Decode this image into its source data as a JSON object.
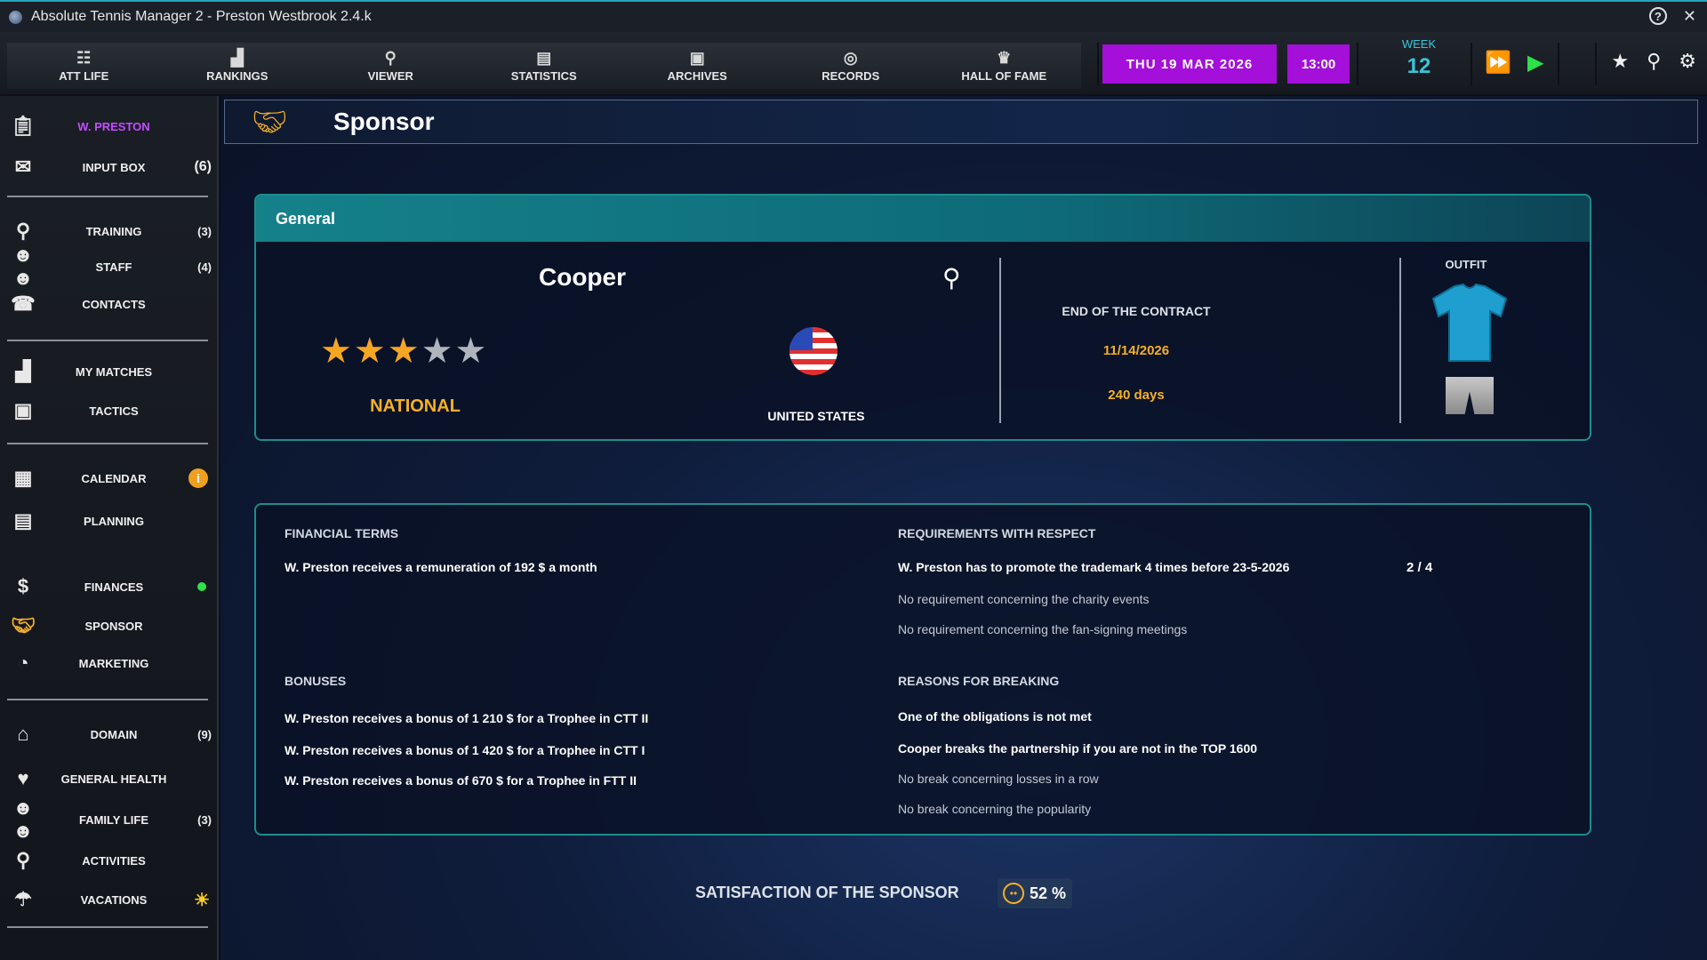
{
  "window": {
    "title": "Absolute Tennis Manager 2  -  Preston Westbrook  2.4.k"
  },
  "nav": {
    "tabs": [
      {
        "label": "ATT LIFE",
        "icon": "att-life-icon"
      },
      {
        "label": "RANKINGS",
        "icon": "rankings-icon"
      },
      {
        "label": "VIEWER",
        "icon": "viewer-icon"
      },
      {
        "label": "STATISTICS",
        "icon": "statistics-icon"
      },
      {
        "label": "ARCHIVES",
        "icon": "archives-icon"
      },
      {
        "label": "RECORDS",
        "icon": "records-icon"
      },
      {
        "label": "HALL OF FAME",
        "icon": "hall-of-fame-icon"
      }
    ],
    "date": "THU  19  MAR  2026",
    "time": "13:00",
    "week_label": "WEEK",
    "week_number": "12"
  },
  "sidebar": {
    "items": [
      {
        "label": "W. PRESTON",
        "count": "",
        "icon": "clipboard-icon",
        "active": true
      },
      {
        "label": "INPUT BOX",
        "count": "(6)",
        "icon": "envelope-icon"
      },
      {
        "label": "TRAINING",
        "count": "(3)",
        "icon": "racket-icon"
      },
      {
        "label": "STAFF",
        "count": "(4)",
        "icon": "staff-icon"
      },
      {
        "label": "CONTACTS",
        "count": "",
        "icon": "contacts-icon"
      },
      {
        "label": "MY MATCHES",
        "count": "",
        "icon": "bar-chart-icon"
      },
      {
        "label": "TACTICS",
        "count": "",
        "icon": "tactics-board-icon"
      },
      {
        "label": "CALENDAR",
        "count": "",
        "icon": "calendar-icon",
        "badge": "i"
      },
      {
        "label": "PLANNING",
        "count": "",
        "icon": "planning-icon"
      },
      {
        "label": "FINANCES",
        "count": "",
        "icon": "dollar-icon"
      },
      {
        "label": "SPONSOR",
        "count": "",
        "icon": "handshake-icon"
      },
      {
        "label": "MARKETING",
        "count": "",
        "icon": "pie-chart-icon"
      },
      {
        "label": "DOMAIN",
        "count": "(9)",
        "icon": "house-icon"
      },
      {
        "label": "GENERAL HEALTH",
        "count": "",
        "icon": "heart-icon"
      },
      {
        "label": "FAMILY LIFE",
        "count": "(3)",
        "icon": "family-icon"
      },
      {
        "label": "ACTIVITIES",
        "count": "",
        "icon": "activities-icon"
      },
      {
        "label": "VACATIONS",
        "count": "",
        "icon": "beach-umbrella-icon"
      }
    ]
  },
  "page": {
    "title": "Sponsor",
    "icon": "handshake-icon"
  },
  "general": {
    "header": "General",
    "sponsor_name": "Cooper",
    "rating_stars": 3,
    "rating_max": 5,
    "level": "NATIONAL",
    "country": "UNITED STATES",
    "contract_label": "END OF THE CONTRACT",
    "contract_date": "11/14/2026",
    "contract_days": "240 days",
    "outfit_label": "OUTFIT",
    "shirt_color": "#1e9fd0"
  },
  "terms": {
    "financial_header": "FINANCIAL TERMS",
    "remuneration": "W. Preston receives a remuneration of 192 $ a month",
    "requirements_header": "REQUIREMENTS WITH RESPECT",
    "requirements": [
      "W. Preston has to promote the trademark 4 times before 23-5-2026",
      "No requirement concerning the charity events",
      "No requirement concerning the fan-signing meetings"
    ],
    "requirement_progress": "2 / 4",
    "bonuses_header": "BONUSES",
    "bonuses": [
      "W. Preston receives a bonus of 1 210 $ for a Trophee in CTT II",
      "W. Preston receives a bonus of 1 420 $ for a Trophee in CTT I",
      "W. Preston receives a bonus of 670 $ for a Trophee in FTT II"
    ],
    "breaking_header": "REASONS FOR BREAKING",
    "breaking": [
      "One of the obligations is not met",
      "Cooper breaks the partnership if you are not in the TOP 1600",
      "No break concerning losses in a row",
      "No break concerning the popularity"
    ]
  },
  "satisfaction": {
    "label": "SATISFACTION OF THE SPONSOR",
    "value": "52 %"
  },
  "colors": {
    "accent_purple": "#a40fd9",
    "accent_teal": "#1e8c8c",
    "gold": "#f5b028",
    "green": "#2ee04a"
  }
}
